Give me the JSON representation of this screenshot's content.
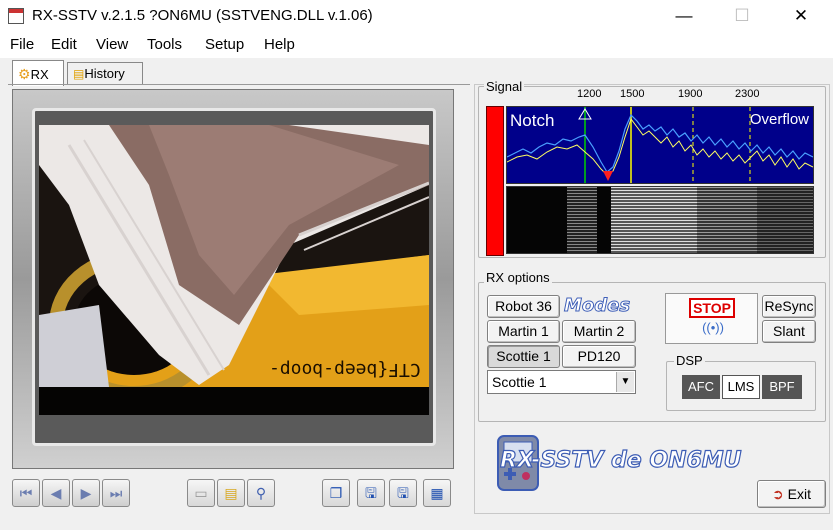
{
  "window": {
    "title": "RX-SSTV v.2.1.5 ?ON6MU (SSTVENG.DLL v.1.06)"
  },
  "menu": [
    "File",
    "Edit",
    "View",
    "Tools",
    "Setup",
    "Help"
  ],
  "tabs": [
    {
      "label": "RX",
      "active": true
    },
    {
      "label": "History",
      "active": false
    }
  ],
  "image": {
    "overlay_text": "CTF{beep-boop-"
  },
  "signal": {
    "label": "Signal",
    "freq_ticks": [
      "1200",
      "1500",
      "1900",
      "2300"
    ],
    "notch_label": "Notch",
    "overflow_label": "Overflow"
  },
  "rx_options": {
    "label": "RX options",
    "modes_logo": "Modes",
    "mode_buttons": [
      "Robot 36",
      "Martin 1",
      "Martin 2",
      "Scottie 1",
      "PD120"
    ],
    "selected_mode": "Scottie 1",
    "stop_label": "STOP",
    "resync_label": "ReSync",
    "slant_label": "Slant",
    "dsp": {
      "label": "DSP",
      "afc": "AFC",
      "lms": "LMS",
      "bpf": "BPF"
    }
  },
  "logo_text": "RX-SSTV de ON6MU",
  "exit_label": "Exit",
  "colors": {
    "spectrum_bg": "#00008a",
    "level_bar": "#ff0000",
    "stop": "#dd0000",
    "logo_outline": "#3c5cb4"
  }
}
